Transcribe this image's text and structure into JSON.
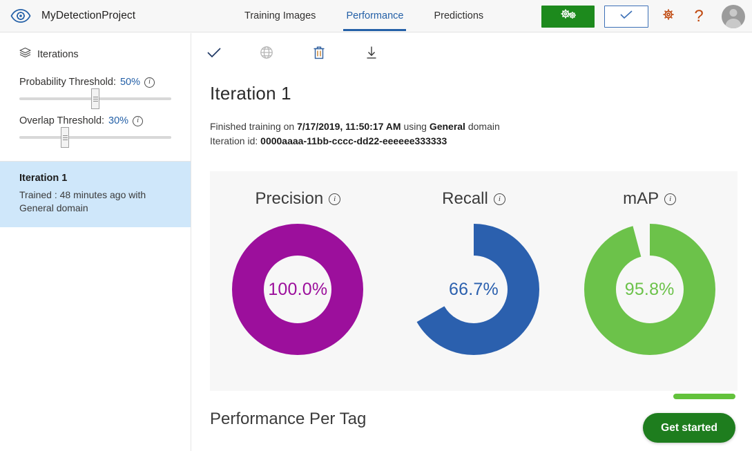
{
  "header": {
    "logo_icon": "eye-gear-icon",
    "project_title": "MyDetectionProject",
    "tabs": [
      {
        "label": "Training Images",
        "active": false
      },
      {
        "label": "Performance",
        "active": true
      },
      {
        "label": "Predictions",
        "active": false
      }
    ],
    "train_button": {
      "icon": "double-gear-icon",
      "label": ""
    },
    "quick_test_button": {
      "icon": "checkmark-icon",
      "label": ""
    },
    "settings_icon": "gear-icon",
    "help_icon": "question-mark-icon",
    "avatar_icon": "user-avatar-icon",
    "colors": {
      "accent_blue": "#2460a7",
      "train_green": "#1d8a1d"
    }
  },
  "sidebar": {
    "section_icon": "layers-icon",
    "section_label": "Iterations",
    "sliders": [
      {
        "label_prefix": "Probability Threshold:",
        "value": "50%",
        "info_icon": "info-icon",
        "position_pct": 50
      },
      {
        "label_prefix": "Overlap Threshold:",
        "value": "30%",
        "info_icon": "info-icon",
        "position_pct": 30
      }
    ],
    "iterations": [
      {
        "name": "Iteration 1",
        "subtitle": "Trained : 48 minutes ago with General domain",
        "selected": true
      }
    ]
  },
  "main": {
    "toolbar": [
      {
        "icon": "checkmark-icon",
        "name": "make-default-iteration",
        "enabled": true
      },
      {
        "icon": "globe-publish-icon",
        "name": "publish-iteration",
        "enabled": false
      },
      {
        "icon": "trash-icon",
        "name": "delete-iteration",
        "enabled": true
      },
      {
        "icon": "download-icon",
        "name": "export-iteration",
        "enabled": true
      }
    ],
    "title": "Iteration 1",
    "meta": {
      "line1_prefix": "Finished training on ",
      "line1_date": "7/17/2019, 11:50:17 AM",
      "line1_middle": " using ",
      "line1_domain": "General",
      "line1_suffix": " domain",
      "line2_prefix": "Iteration id: ",
      "line2_id": "0000aaaa-11bb-cccc-dd22-eeeeee333333"
    },
    "performance_per_tag_title": "Performance Per Tag"
  },
  "chart_data": [
    {
      "type": "pie",
      "title": "Precision",
      "info_icon": "info-icon",
      "value": 100.0,
      "value_label": "100.0%",
      "color": "#9c0f9c",
      "track_color": "#f7f7f7",
      "max": 100
    },
    {
      "type": "pie",
      "title": "Recall",
      "info_icon": "info-icon",
      "value": 66.7,
      "value_label": "66.7%",
      "color": "#2b60ae",
      "track_color": "#f7f7f7",
      "max": 100
    },
    {
      "type": "pie",
      "title": "mAP",
      "info_icon": "info-icon",
      "value": 95.8,
      "value_label": "95.8%",
      "color": "#6cc24a",
      "track_color": "#f7f7f7",
      "max": 100
    }
  ],
  "floating": {
    "get_started_label": "Get started"
  }
}
